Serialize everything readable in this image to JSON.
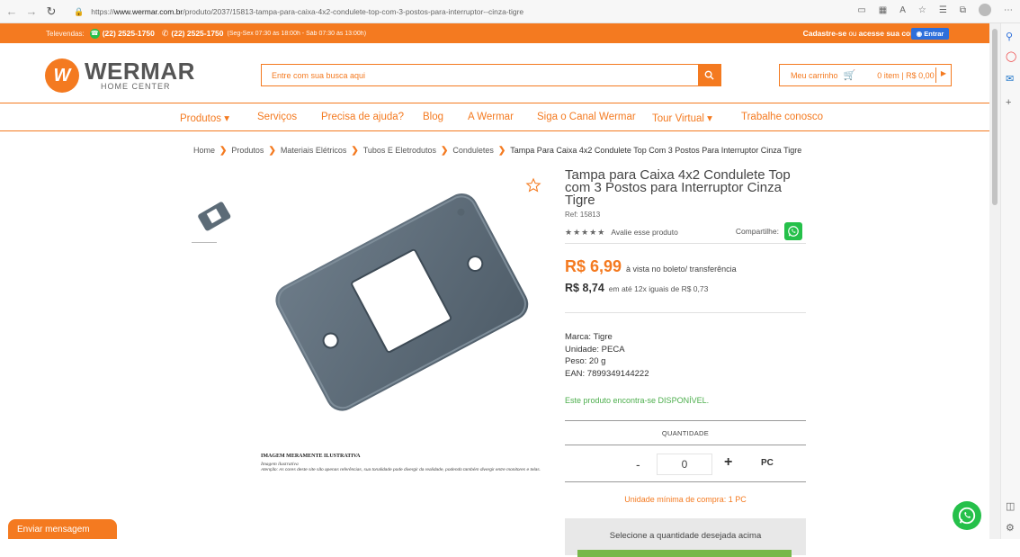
{
  "browser": {
    "url_prefix": "https://",
    "url_host": "www.wermar.com.br",
    "url_path": "/produto/2037/15813-tampa-para-caixa-4x2-condulete-top-com-3-postos-para-interruptor--cinza-tigre"
  },
  "topbar": {
    "tel_label": "Televendas:",
    "phone1": "(22) 2525-1750",
    "phone2": "(22) 2525-1750",
    "hours": "(Seg-Sex 07:30 às 18:00h - Sáb 07:30 às 13:00h)",
    "signup": "Cadastre-se",
    "or": " ou ",
    "login": "acesse sua conta",
    "enter_button": "Entrar"
  },
  "brand": {
    "name": "WERMAR",
    "subtitle": "HOME CENTER",
    "color": "#f47a20"
  },
  "search": {
    "placeholder": "Entre com sua busca aqui"
  },
  "cart": {
    "label": "Meu carrinho",
    "total": "0 item | R$ 0,00"
  },
  "menu": {
    "items": [
      "Produtos ▾",
      "Serviços",
      "Precisa de ajuda?",
      "Blog",
      "A Wermar",
      "Siga o Canal Wermar",
      "Tour Virtual ▾",
      "Trabalhe conosco"
    ]
  },
  "breadcrumb": [
    "Home",
    "Produtos",
    "Materiais Elétricos",
    "Tubos E Eletrodutos",
    "Conduletes",
    "Tampa Para Caixa 4x2 Condulete Top Com 3 Postos Para Interruptor Cinza Tigre"
  ],
  "gallery": {
    "disclaimer_title": "IMAGEM MERAMENTE ILUSTRATIVA",
    "disclaimer_sub": "Imagem ilustrativa",
    "disclaimer_note": "Atenção: As cores deste site são apenas referências, sua tonalidade pode divergir da realidade, podendo também divergir entre monitores e telas."
  },
  "product": {
    "title": "Tampa para Caixa 4x2 Condulete Top com 3 Postos para Interruptor Cinza Tigre",
    "ref": "Ref: 15813",
    "rating_stars": 5,
    "rate_link": "Avalie esse produto",
    "share_label": "Compartilhe:",
    "price_cash": "R$ 6,99",
    "price_cash_note": "à vista no boleto/ transferência",
    "price_installment": "R$ 8,74",
    "price_installment_note": "em até 12x iguais de R$ 0,73",
    "specs": [
      "Marca: Tigre",
      "Unidade: PECA",
      "Peso: 20 g",
      "EAN: 7899349144222"
    ],
    "stock": "Este produto encontra-se DISPONÍVEL.",
    "qty_label": "QUANTIDADE",
    "qty_minus": "-",
    "qty_value": "0",
    "qty_plus": "+",
    "qty_unit": "PC",
    "min_buy": "Unidade mínima de compra: 1 PC",
    "select_prompt": "Selecione a quantidade desejada acima"
  },
  "chat": {
    "label": "Enviar mensagem"
  },
  "colors": {
    "accent": "#f47a20",
    "whatsapp": "#25c04a",
    "available": "#4cae4c",
    "product_gray": "#5c6b77"
  }
}
